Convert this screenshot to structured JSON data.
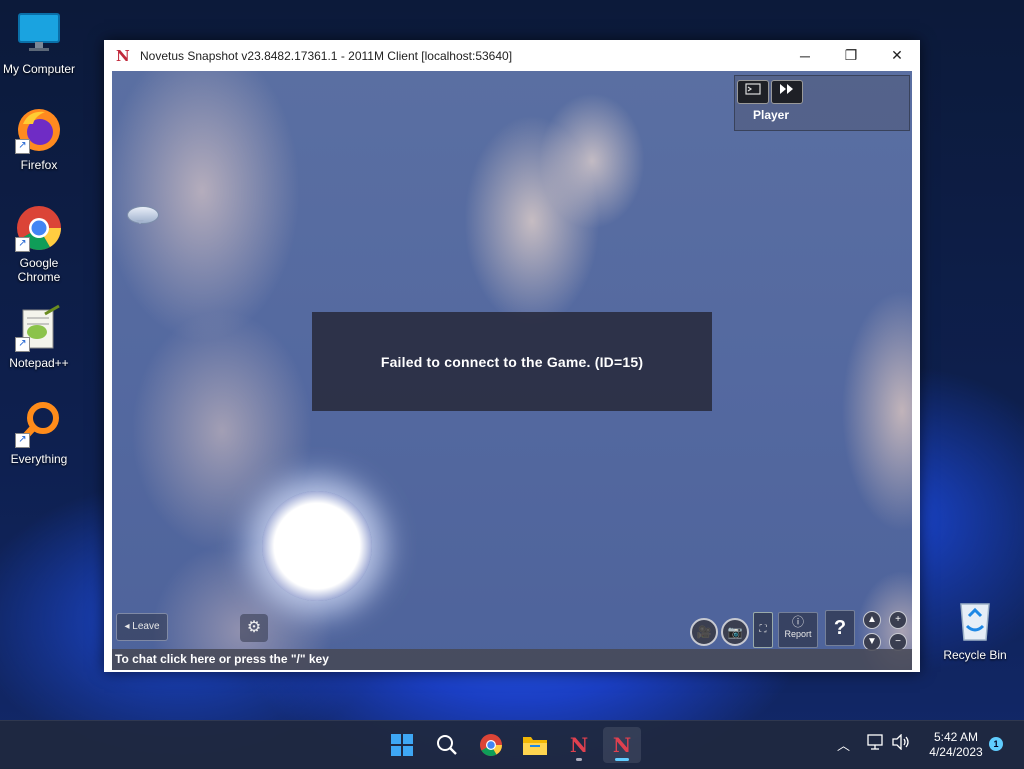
{
  "desktop": {
    "icons": [
      {
        "label": "My Computer",
        "icon": "monitor-icon"
      },
      {
        "label": "Firefox",
        "icon": "firefox-icon"
      },
      {
        "label": "Google Chrome",
        "icon": "chrome-icon"
      },
      {
        "label": "Notepad++",
        "icon": "notepadpp-icon"
      },
      {
        "label": "Everything",
        "icon": "search-magnifier-icon"
      },
      {
        "label": "Recycle Bin",
        "icon": "recycle-bin-icon"
      }
    ]
  },
  "window": {
    "title": "Novetus Snapshot v23.8482.17361.1 - 2011M Client [localhost:53640]",
    "controls": {
      "minimize": "─",
      "maximize": "❐",
      "close": "✕"
    }
  },
  "game": {
    "player_panel": {
      "label": "Player"
    },
    "error_message": "Failed to connect to the Game. (ID=15)",
    "leave_label": "Leave",
    "report_label": "Report",
    "help_label": "?",
    "chat_prompt": "To chat click here or press the \"/\" key"
  },
  "taskbar": {
    "items": [
      "start",
      "search",
      "chrome",
      "file-explorer",
      "novetus",
      "novetus-active"
    ],
    "clock_time": "5:42 AM",
    "clock_date": "4/24/2023",
    "notification_count": "1"
  },
  "colors": {
    "accent": "#60cdff",
    "sky": "#5469a0",
    "error_box": "#282a3c"
  }
}
